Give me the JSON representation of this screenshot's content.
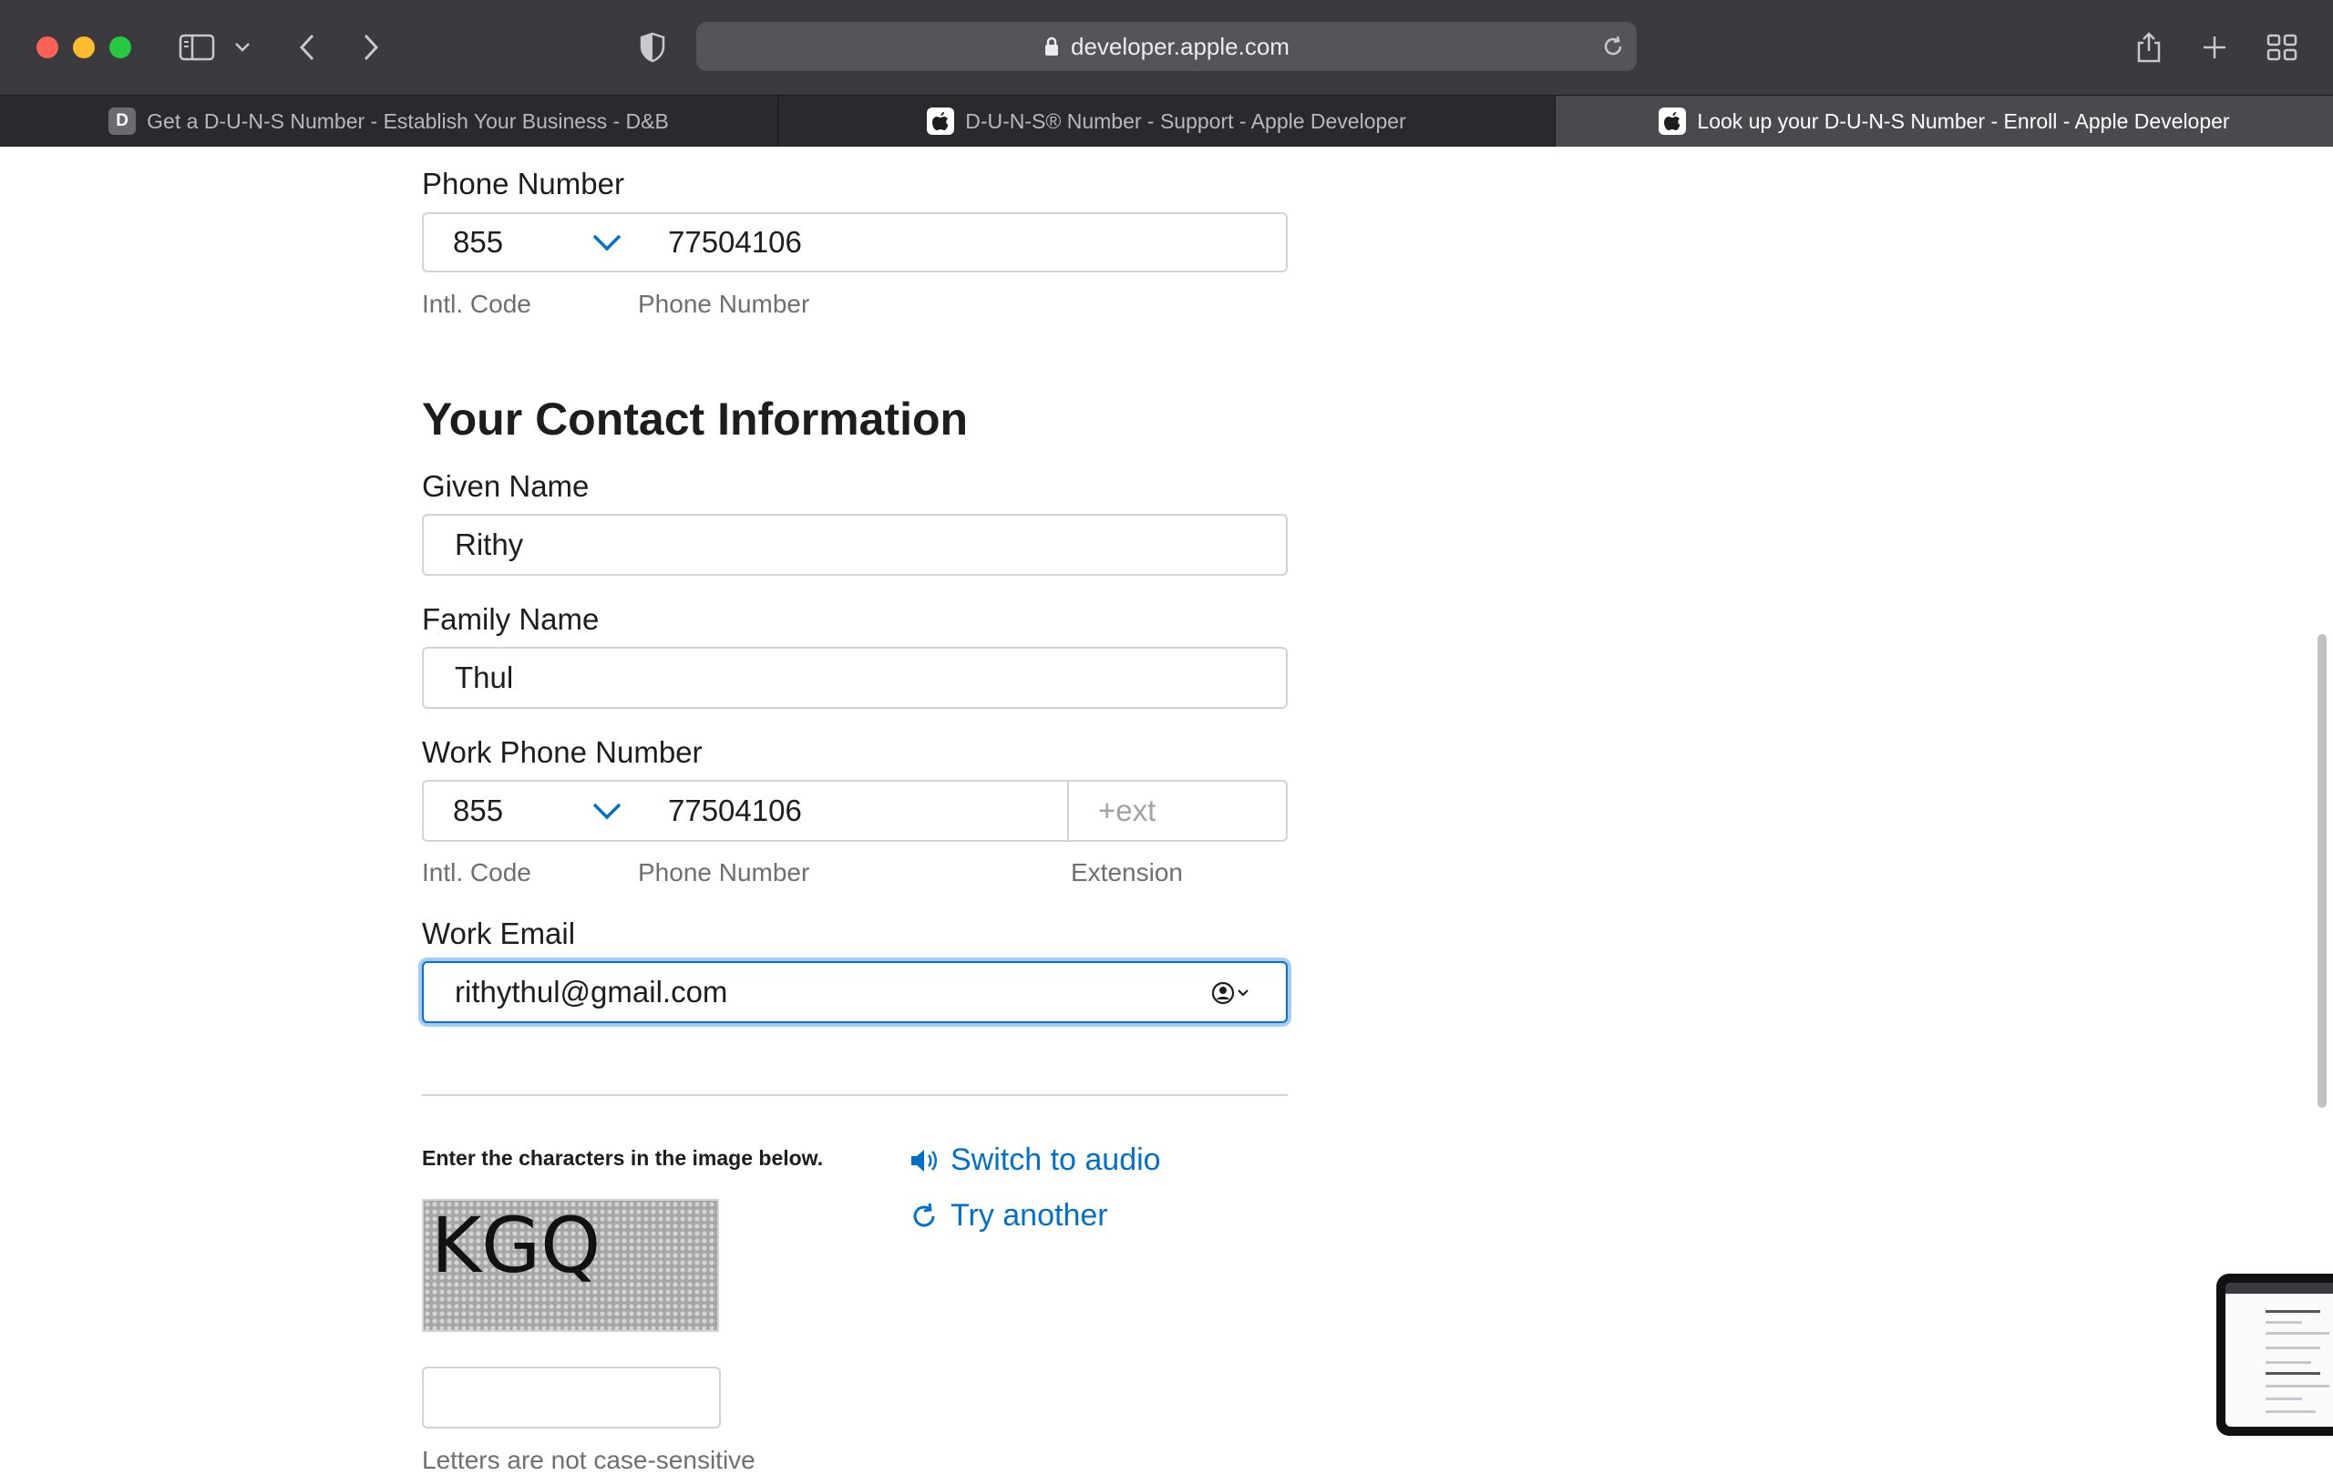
{
  "browser": {
    "url": "developer.apple.com",
    "tabs": [
      {
        "favicon": "D",
        "title": "Get a D-U-N-S Number - Establish Your Business - D&B"
      },
      {
        "favicon": "apple-icon",
        "title": "D-U-N-S® Number - Support - Apple Developer"
      },
      {
        "favicon": "apple-icon",
        "title": "Look up your D-U-N-S Number - Enroll - Apple Developer"
      }
    ],
    "active_tab": 2
  },
  "company_phone": {
    "label": "Phone Number",
    "intl_code": "855",
    "number": "77504106",
    "intl_code_caption": "Intl. Code",
    "number_caption": "Phone Number"
  },
  "contact": {
    "heading": "Your Contact Information",
    "given_name": {
      "label": "Given Name",
      "value": "Rithy"
    },
    "family_name": {
      "label": "Family Name",
      "value": "Thul"
    },
    "work_phone": {
      "label": "Work Phone Number",
      "intl_code": "855",
      "number": "77504106",
      "extension_placeholder": "+ext",
      "intl_code_caption": "Intl. Code",
      "number_caption": "Phone Number",
      "extension_caption": "Extension"
    },
    "work_email": {
      "label": "Work Email",
      "value": "rithythul@gmail.com"
    }
  },
  "captcha": {
    "instruction": "Enter the characters in the image below.",
    "image_text": "KGQ",
    "switch_audio": "Switch to audio",
    "try_another": "Try another",
    "note": "Letters are not case-sensitive"
  },
  "colors": {
    "link": "#0070c9",
    "focus_ring": "#0071e3",
    "chrome_bg": "#3b3a3f"
  }
}
